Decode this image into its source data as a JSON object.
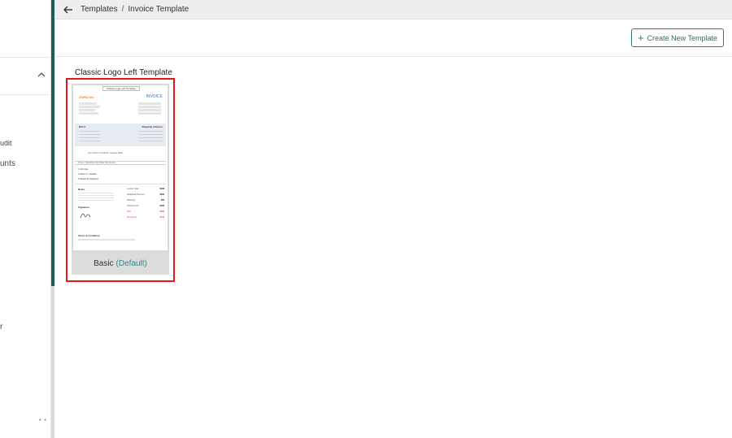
{
  "sidebar": {
    "fragments": [
      "udit",
      "unts",
      "r"
    ],
    "more_dots": "• •"
  },
  "header": {
    "breadcrumb": [
      "Templates",
      "Invoice Template"
    ],
    "separator": "/"
  },
  "toolbar": {
    "create_label": "Create New Template"
  },
  "template": {
    "title": "Classic Logo Left Template",
    "name": "Basic",
    "default_label": "(Default)",
    "preview": {
      "tag": "Classic Logo Left Template",
      "logo": "ZOHO Inv",
      "heading": "INVOICE",
      "bill_to": "Bill to",
      "ship_to": "Shipping Address",
      "note": "List of items / products / services billed",
      "columns": "#   Item / Description   Qty   Rate   Tax   Amount",
      "rows": [
        "1  John doe",
        "2  James K. Caldwell",
        "3  Tamara R. McQueen"
      ],
      "notes": "Notes",
      "signature": "Signature",
      "terms": "Terms & Condition",
      "totals": [
        {
          "label": "Invoice Total",
          "value": "$408"
        },
        {
          "label": "Additional Discount",
          "value": "$408"
        },
        {
          "label": "Shipping",
          "value": "$90"
        },
        {
          "label": "Total Amount",
          "value": "$408"
        },
        {
          "label": "Paid",
          "value": "$308"
        },
        {
          "label": "Remaining",
          "value": "$100"
        }
      ]
    }
  },
  "colors": {
    "accent": "#1e5c52",
    "highlight": "#e01818",
    "default_text": "#2b8a8a"
  }
}
